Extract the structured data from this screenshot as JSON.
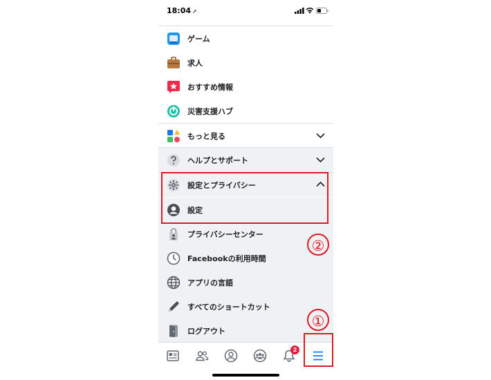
{
  "status_bar": {
    "time": "18:04",
    "location_glyph": "➚"
  },
  "menu": {
    "items": [
      {
        "label": "ゲーム",
        "icon": "game-icon"
      },
      {
        "label": "求人",
        "icon": "briefcase-icon"
      },
      {
        "label": "おすすめ情報",
        "icon": "star-message-icon"
      },
      {
        "label": "災害支援ハブ",
        "icon": "crisis-hub-icon"
      },
      {
        "label": "もっと見る",
        "icon": "shapes-icon"
      },
      {
        "label": "ヘルプとサポート",
        "icon": "help-icon"
      },
      {
        "label": "設定とプライバシー",
        "icon": "gear-icon"
      },
      {
        "label": "設定",
        "icon": "user-icon"
      },
      {
        "label": "プライバシーセンター",
        "icon": "lock-person-icon"
      },
      {
        "label": "Facebookの利用時間",
        "icon": "clock-icon"
      },
      {
        "label": "アプリの言語",
        "icon": "globe-icon"
      },
      {
        "label": "すべてのショートカット",
        "icon": "pencil-icon"
      },
      {
        "label": "ログアウト",
        "icon": "door-icon"
      }
    ]
  },
  "tab_bar": {
    "tabs": [
      {
        "icon": "news-feed-icon"
      },
      {
        "icon": "friends-icon"
      },
      {
        "icon": "profile-icon"
      },
      {
        "icon": "groups-icon"
      },
      {
        "icon": "bell-icon"
      },
      {
        "icon": "menu-icon"
      }
    ],
    "notification_badge": "2"
  },
  "annotations": {
    "step1": "①",
    "step2": "②"
  },
  "colors": {
    "accent_red": "#e0181f",
    "facebook_blue": "#1877f2",
    "badge_red": "#e41e3f"
  }
}
